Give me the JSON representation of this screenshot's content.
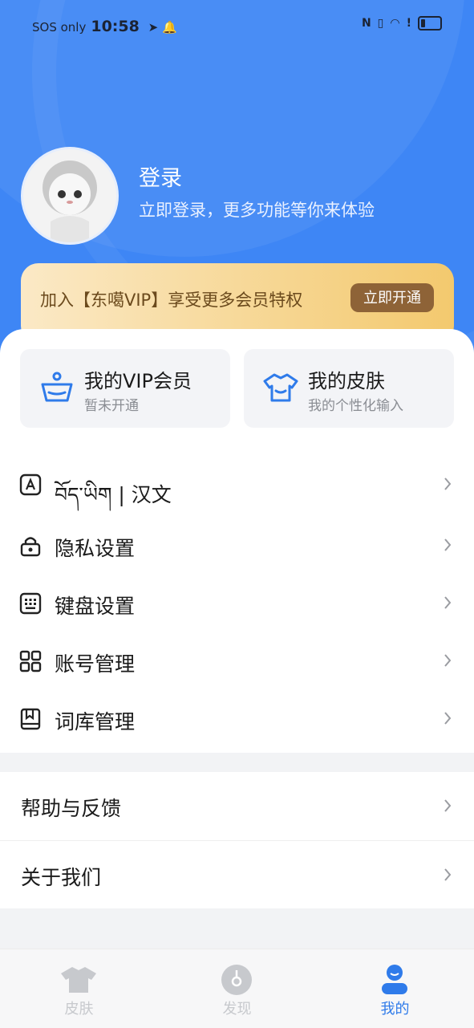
{
  "status_bar": {
    "carrier": "SOS only",
    "time": "10:58"
  },
  "profile": {
    "title": "登录",
    "subtitle": "立即登录，更多功能等你来体验"
  },
  "vip_banner": {
    "text": "加入【东噶VIP】享受更多会员特权",
    "button": "立即开通"
  },
  "features": [
    {
      "title": "我的VIP会员",
      "subtitle": "暂未开通",
      "icon": "basket-icon"
    },
    {
      "title": "我的皮肤",
      "subtitle": "我的个性化输入",
      "icon": "shirt-icon"
    }
  ],
  "menu": [
    {
      "label": "བོད་ཡིག | 汉文",
      "icon": "language-icon"
    },
    {
      "label": "隐私设置",
      "icon": "lock-icon"
    },
    {
      "label": "键盘设置",
      "icon": "keyboard-icon"
    },
    {
      "label": "账号管理",
      "icon": "grid-icon"
    },
    {
      "label": "词库管理",
      "icon": "book-icon"
    }
  ],
  "menu2": [
    {
      "label": "帮助与反馈"
    },
    {
      "label": "关于我们"
    }
  ],
  "bottom_nav": [
    {
      "label": "皮肤",
      "active": false,
      "icon": "skin-icon"
    },
    {
      "label": "发现",
      "active": false,
      "icon": "discover-icon"
    },
    {
      "label": "我的",
      "active": true,
      "icon": "profile-icon"
    }
  ],
  "colors": {
    "primary": "#3e86f5",
    "vip_gold": "#f3c96e",
    "vip_button": "#8e6337",
    "inactive": "#c7c9cd"
  }
}
